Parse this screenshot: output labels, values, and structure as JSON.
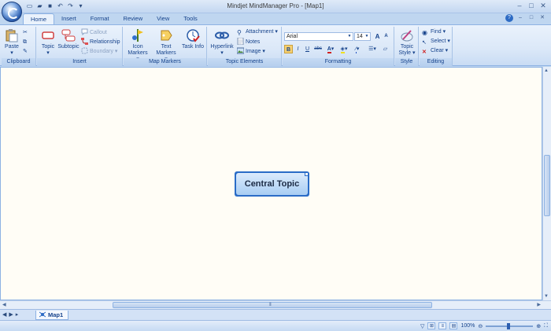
{
  "app": {
    "title": "Mindjet MindManager Pro - [Map1]"
  },
  "quick_access": [
    "new-icon",
    "open-icon",
    "save-icon",
    "undo-icon",
    "redo-icon"
  ],
  "tabs": [
    {
      "label": "Home",
      "active": true
    },
    {
      "label": "Insert"
    },
    {
      "label": "Format"
    },
    {
      "label": "Review"
    },
    {
      "label": "View"
    },
    {
      "label": "Tools"
    }
  ],
  "ribbon": {
    "clipboard": {
      "label": "Clipboard",
      "paste": "Paste"
    },
    "insert": {
      "label": "Insert",
      "topic": "Topic",
      "subtopic": "Subtopic",
      "callout": "Callout",
      "relationship": "Relationship",
      "boundary": "Boundary"
    },
    "map_markers": {
      "label": "Map Markers",
      "icon_markers": "Icon Markers",
      "text_markers": "Text Markers",
      "task_info": "Task Info"
    },
    "topic_elements": {
      "label": "Topic Elements",
      "hyperlink": "Hyperlink",
      "attachment": "Attachment",
      "notes": "Notes",
      "image": "Image"
    },
    "formatting": {
      "label": "Formatting",
      "font": "Arial",
      "size": "14",
      "bold": "B",
      "italic": "I",
      "underline": "U",
      "strike": "abc",
      "grow": "A",
      "shrink": "A"
    },
    "style": {
      "label": "Style",
      "topic_style": "Topic Style"
    },
    "editing": {
      "label": "Editing",
      "find": "Find",
      "select": "Select",
      "clear": "Clear"
    }
  },
  "canvas": {
    "central_topic": "Central Topic",
    "background": "#fffdf6"
  },
  "sheet": {
    "tab_label": "Map1"
  },
  "status": {
    "zoom": "100%"
  },
  "colors": {
    "accent": "#15428b",
    "topic_border": "#2a6cc7"
  }
}
